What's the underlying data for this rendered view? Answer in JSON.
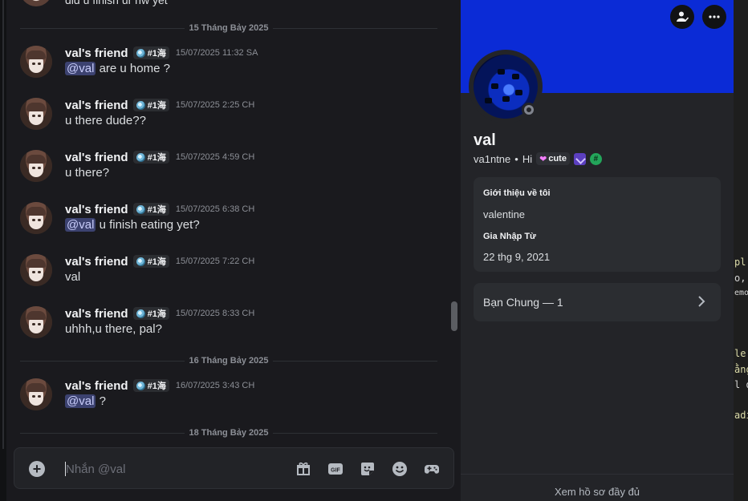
{
  "chat": {
    "partial_message": "did u finish ur hw yet",
    "dividers": [
      "15 Tháng Bảy 2025",
      "16 Tháng Bảy 2025",
      "18 Tháng Bảy 2025"
    ],
    "messages": [
      {
        "username": "val's friend",
        "tag": "#1海",
        "timestamp": "15/07/2025 11:32 SA",
        "mention": "@val",
        "text": "are u home ?"
      },
      {
        "username": "val's friend",
        "tag": "#1海",
        "timestamp": "15/07/2025 2:25 CH",
        "mention": "",
        "text": "u there dude??"
      },
      {
        "username": "val's friend",
        "tag": "#1海",
        "timestamp": "15/07/2025 4:59 CH",
        "mention": "",
        "text": "u there?"
      },
      {
        "username": "val's friend",
        "tag": "#1海",
        "timestamp": "15/07/2025 6:38 CH",
        "mention": "@val",
        "text": "u finish eating yet?"
      },
      {
        "username": "val's friend",
        "tag": "#1海",
        "timestamp": "15/07/2025 7:22 CH",
        "mention": "",
        "text": "val"
      },
      {
        "username": "val's friend",
        "tag": "#1海",
        "timestamp": "15/07/2025 8:33 CH",
        "mention": "",
        "text": "uhhh,u there, pal?"
      },
      {
        "username": "val's friend",
        "tag": "#1海",
        "timestamp": "16/07/2025 3:43 CH",
        "mention": "@val",
        "text": "?"
      }
    ],
    "composer": {
      "placeholder": "Nhắn @val"
    },
    "composer_icons": [
      "gift-icon",
      "gif-icon",
      "sticker-icon",
      "emoji-icon",
      "game-controller-icon"
    ]
  },
  "profile": {
    "display_name": "val",
    "username": "va1ntne",
    "separator": "•",
    "status_text": "Hi",
    "badge_cute": "cute",
    "about_label": "Giới thiệu về tôi",
    "about_value": "valentine",
    "joined_label": "Gia Nhập Từ",
    "joined_value": "22 thg 9, 2021",
    "mutual_label": "Bạn Chung — 1",
    "footer": "Xem hồ sơ đầy đủ",
    "banner_color": "#0b2bd6"
  },
  "background_code": {
    "lines": [
      {
        "text": "pl",
        "color": "#dcdcaa"
      },
      {
        "text": "o,",
        "color": "#d4d4d4"
      },
      {
        "text": "emo",
        "color": "#d4d4d4"
      },
      {
        "text": "le,",
        "color": "#dcdcaa"
      },
      {
        "text": "ằng",
        "color": "#dcdcaa"
      },
      {
        "text": "l d",
        "color": "#d4d4d4"
      },
      {
        "text": "adi",
        "color": "#dcdcaa"
      }
    ]
  }
}
